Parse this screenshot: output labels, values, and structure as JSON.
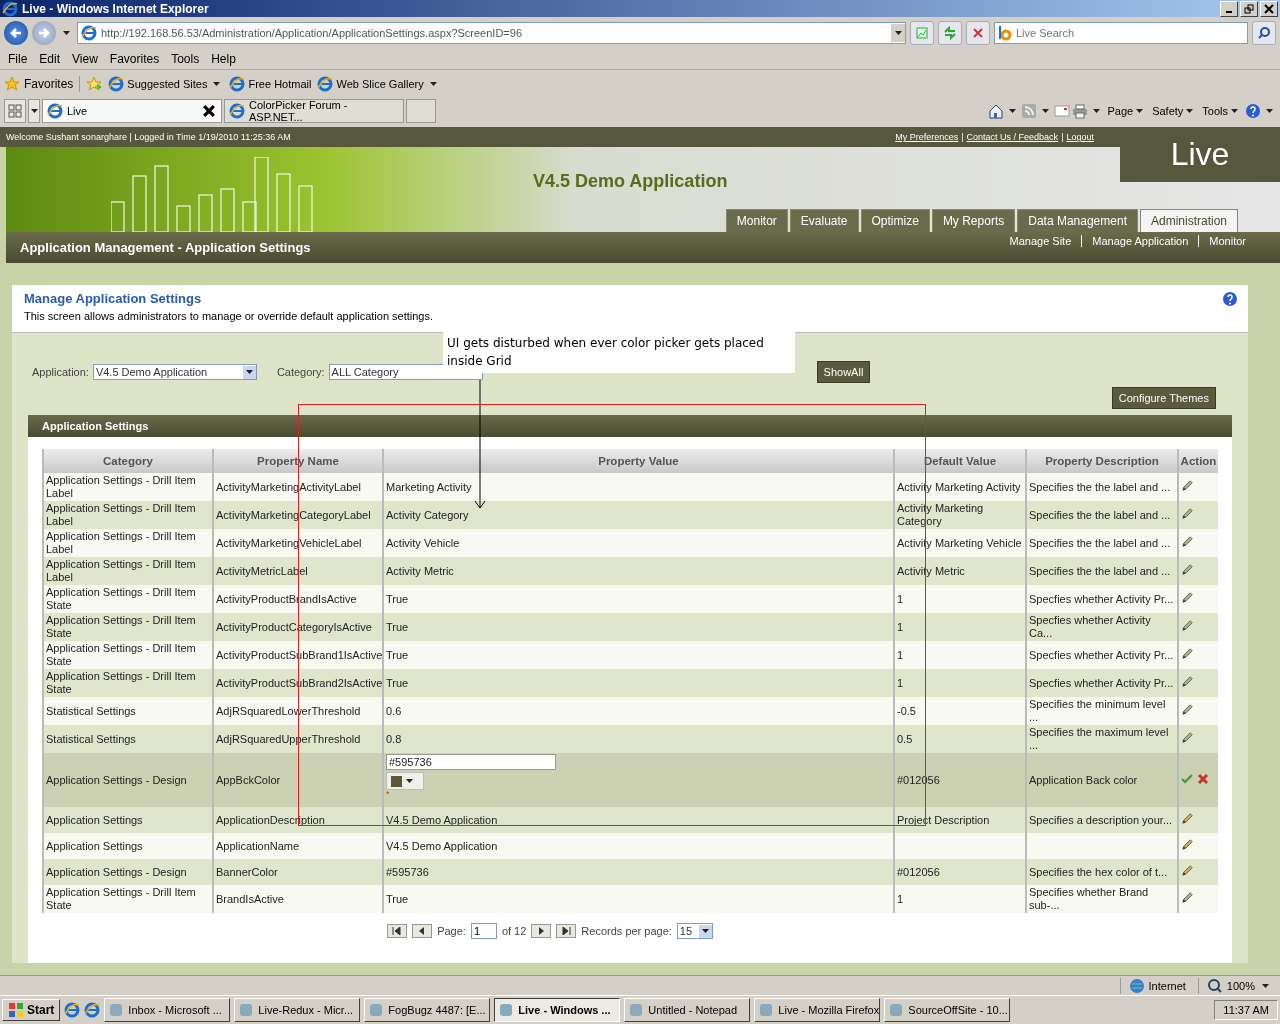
{
  "window": {
    "title": "Live - Windows Internet Explorer"
  },
  "address": "http://192.168.56.53/Administration/Application/ApplicationSettings.aspx?ScreenID=96",
  "search": {
    "placeholder": "Live Search"
  },
  "menu": [
    "File",
    "Edit",
    "View",
    "Favorites",
    "Tools",
    "Help"
  ],
  "favorites_bar": {
    "label": "Favorites",
    "items": [
      {
        "label": "Suggested Sites",
        "dropdown": true
      },
      {
        "label": "Free Hotmail",
        "dropdown": false
      },
      {
        "label": "Web Slice Gallery",
        "dropdown": true
      }
    ]
  },
  "browser_tabs": [
    {
      "label": "Live",
      "selected": true
    },
    {
      "label": "ColorPicker Forum - ASP.NET...",
      "selected": false
    }
  ],
  "command_bar": [
    "Page",
    "Safety",
    "Tools"
  ],
  "header": {
    "welcome": "Welcome Sushant sonarghare | Logged in Time 1/19/2010 11:25:36 AM",
    "links": [
      "My Preferences",
      "Contact Us / Feedback",
      "Logout"
    ],
    "link_separator": "|",
    "logo": "Live",
    "app_title": "V4.5 Demo Application",
    "nav_tabs": [
      {
        "label": "Monitor",
        "selected": false
      },
      {
        "label": "Evaluate",
        "selected": false
      },
      {
        "label": "Optimize",
        "selected": false
      },
      {
        "label": "My Reports",
        "selected": false
      },
      {
        "label": "Data Management",
        "selected": false
      },
      {
        "label": "Administration",
        "selected": true
      }
    ],
    "sub_nav": [
      "Manage Site",
      "Manage Application",
      "Monitor"
    ],
    "page_title": "Application Management - Application Settings"
  },
  "panel": {
    "title": "Manage Application Settings",
    "description": "This screen allows administrators to manage or override default application settings."
  },
  "filters": {
    "application_label": "Application:",
    "application_value": "V4.5 Demo Application",
    "category_label": "Category:",
    "category_value": "ALL Category",
    "show_all": "ShowAll"
  },
  "annotation": "UI gets disturbed when ever color picker gets placed inside Grid",
  "configure_themes": "Configure Themes",
  "grid": {
    "title": "Application Settings",
    "columns": [
      "Category",
      "Property Name",
      "Property Value",
      "Default Value",
      "Property Description",
      "Action"
    ],
    "rows": [
      {
        "category": "Application Settings - Drill Item Label",
        "name": "ActivityMarketingActivityLabel",
        "value": "Marketing Activity",
        "default": "Activity Marketing Activity",
        "description": "Specifies the the label and ...",
        "editing": false
      },
      {
        "category": "Application Settings - Drill Item Label",
        "name": "ActivityMarketingCategoryLabel",
        "value": "Activity Category",
        "default": "Activity Marketing Category",
        "description": "Specifies the the label and ...",
        "editing": false
      },
      {
        "category": "Application Settings - Drill Item Label",
        "name": "ActivityMarketingVehicleLabel",
        "value": "Activity Vehicle",
        "default": "Activity Marketing Vehicle",
        "description": "Specifies the the label and ...",
        "editing": false
      },
      {
        "category": "Application Settings - Drill Item Label",
        "name": "ActivityMetricLabel",
        "value": "Activity Metric",
        "default": "Activity Metric",
        "description": "Specifies the the label and ...",
        "editing": false
      },
      {
        "category": "Application Settings - Drill Item State",
        "name": "ActivityProductBrandIsActive",
        "value": "True",
        "default": "1",
        "description": "Specfies whether Activity Pr...",
        "editing": false
      },
      {
        "category": "Application Settings - Drill Item State",
        "name": "ActivityProductCategoryIsActive",
        "value": "True",
        "default": "1",
        "description": "Specfies whether Activity Ca...",
        "editing": false
      },
      {
        "category": "Application Settings - Drill Item State",
        "name": "ActivityProductSubBrand1IsActive",
        "value": "True",
        "default": "1",
        "description": "Specfies whether Activity Pr...",
        "editing": false
      },
      {
        "category": "Application Settings - Drill Item State",
        "name": "ActivityProductSubBrand2IsActive",
        "value": "True",
        "default": "1",
        "description": "Specfies whether Activity Pr...",
        "editing": false
      },
      {
        "category": "Statistical Settings",
        "name": "AdjRSquaredLowerThreshold",
        "value": "0.6",
        "default": "-0.5",
        "description": "Specifies the minimum level ...",
        "editing": false
      },
      {
        "category": "Statistical Settings",
        "name": "AdjRSquaredUpperThreshold",
        "value": "0.8",
        "default": "0.5",
        "description": "Specifies the maximum level ...",
        "editing": false
      },
      {
        "category": "Application Settings - Design",
        "name": "AppBckColor",
        "value": "#595736",
        "required_mark": "*",
        "default": "#012056",
        "description": "Application Back color",
        "editing": true
      },
      {
        "category": "Application Settings",
        "name": "ApplicationDescription",
        "value": "V4.5 Demo Application",
        "default": "Project Description",
        "description": "Specifies a description your...",
        "editing": false
      },
      {
        "category": "Application Settings",
        "name": "ApplicationName",
        "value": "V4.5 Demo Application",
        "editing": false
      },
      {
        "category": "Application Settings - Design",
        "name": "BannerColor",
        "value": "#595736",
        "default": "#012056",
        "description": "Specifies the hex color of t...",
        "editing": false
      },
      {
        "category": "Application Settings - Drill Item State",
        "name": "BrandIsActive",
        "value": "True",
        "default": "1",
        "description": "Specifies whether Brand sub-...",
        "editing": false
      }
    ]
  },
  "pager": {
    "page_label": "Page:",
    "page": "1",
    "of": "of 12",
    "per_page_label": "Records per page:",
    "per_page": "15"
  },
  "status_bar": {
    "zone": "Internet",
    "zoom": "100%"
  },
  "taskbar": {
    "start": "Start",
    "items": [
      {
        "label": "Inbox - Microsoft ...",
        "selected": false
      },
      {
        "label": "Live-Redux - Micr...",
        "selected": false
      },
      {
        "label": "FogBugz 4487: [E...",
        "selected": false
      },
      {
        "label": "Live - Windows ...",
        "selected": true
      },
      {
        "label": "Untitled - Notepad",
        "selected": false
      },
      {
        "label": "Live - Mozilla Firefox",
        "selected": false
      },
      {
        "label": "SourceOffSite - 10...",
        "selected": false
      }
    ],
    "clock": "11:37 AM"
  }
}
